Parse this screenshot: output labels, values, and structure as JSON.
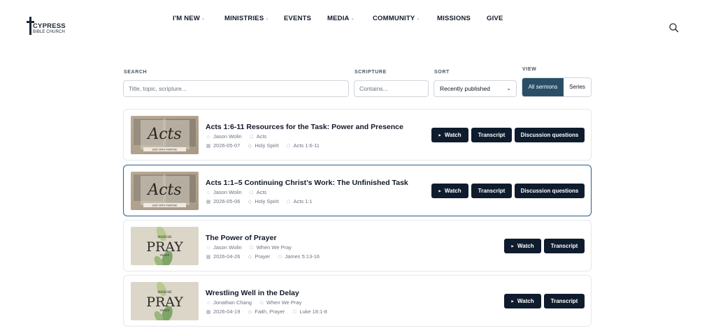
{
  "logo": {
    "name": "CYPRESS",
    "subtitle": "BIBLE CHURCH"
  },
  "nav": {
    "items": [
      {
        "label": "I'M NEW",
        "dropdown": true
      },
      {
        "label": "MINISTRIES",
        "dropdown": true
      },
      {
        "label": "EVENTS",
        "dropdown": false
      },
      {
        "label": "MEDIA",
        "dropdown": true
      },
      {
        "label": "COMMUNITY",
        "dropdown": true
      },
      {
        "label": "MISSIONS",
        "dropdown": false
      },
      {
        "label": "GIVE",
        "dropdown": false
      }
    ],
    "search_icon": "search-icon"
  },
  "filters": {
    "search": {
      "label": "SEARCH",
      "placeholder": "Title, topic, scripture..."
    },
    "scripture": {
      "label": "SCRIPTURE",
      "placeholder": "Contains..."
    },
    "sort": {
      "label": "SORT",
      "value": "Recently published"
    },
    "view": {
      "label": "VIEW",
      "options": [
        "All sermons",
        "Series"
      ],
      "active": "All sermons"
    }
  },
  "sermons": [
    {
      "title": "Acts 1:6-11 Resources for the Task: Power and Presence",
      "speaker": "Jason Wolin",
      "series": "Acts",
      "date": "2026-05-07",
      "topics": "Holy Spirit",
      "scripture": "Acts 1:6-11",
      "thumbnail": {
        "art": "Acts",
        "caption": "SENT WITH PURPOSE"
      },
      "buttons": {
        "watch": "Watch",
        "transcript": "Transcript",
        "discussion": "Discussion questions"
      }
    },
    {
      "title": "Acts 1:1–5 Continuing Christ’s Work: The Unfinished Task",
      "speaker": "Jason Wolin",
      "series": "Acts",
      "date": "2026-05-06",
      "topics": "Holy Spirit",
      "scripture": "Acts 1:1",
      "thumbnail": {
        "art": "Acts",
        "caption": "SENT WITH PURPOSE"
      },
      "buttons": {
        "watch": "Watch",
        "transcript": "Transcript",
        "discussion": "Discussion questions"
      }
    },
    {
      "title": "The Power of Prayer",
      "speaker": "Jason Wolin",
      "series": "When We Pray",
      "date": "2026-04-26",
      "topics": "Prayer",
      "scripture": "James 5:13-16",
      "thumbnail": {
        "art": "PRAY",
        "caption_top": "WHEN WE",
        "caption_bottom": "PRAYER"
      },
      "buttons": {
        "watch": "Watch",
        "transcript": "Transcript"
      }
    },
    {
      "title": "Wrestling Well in the Delay",
      "speaker": "Jonathan Chang",
      "series": "When We Pray",
      "date": "2026-04-19",
      "topics": "Faith, Prayer",
      "scripture": "Luke 18:1-8",
      "thumbnail": {
        "art": "PRAY",
        "caption_top": "WHEN WE",
        "caption_bottom": "PRAYER"
      },
      "buttons": {
        "watch": "Watch",
        "transcript": "Transcript"
      }
    }
  ],
  "colors": {
    "accent": "#294e66",
    "button_dark": "#0f1c2e",
    "selected_border": "#2c5d86"
  }
}
